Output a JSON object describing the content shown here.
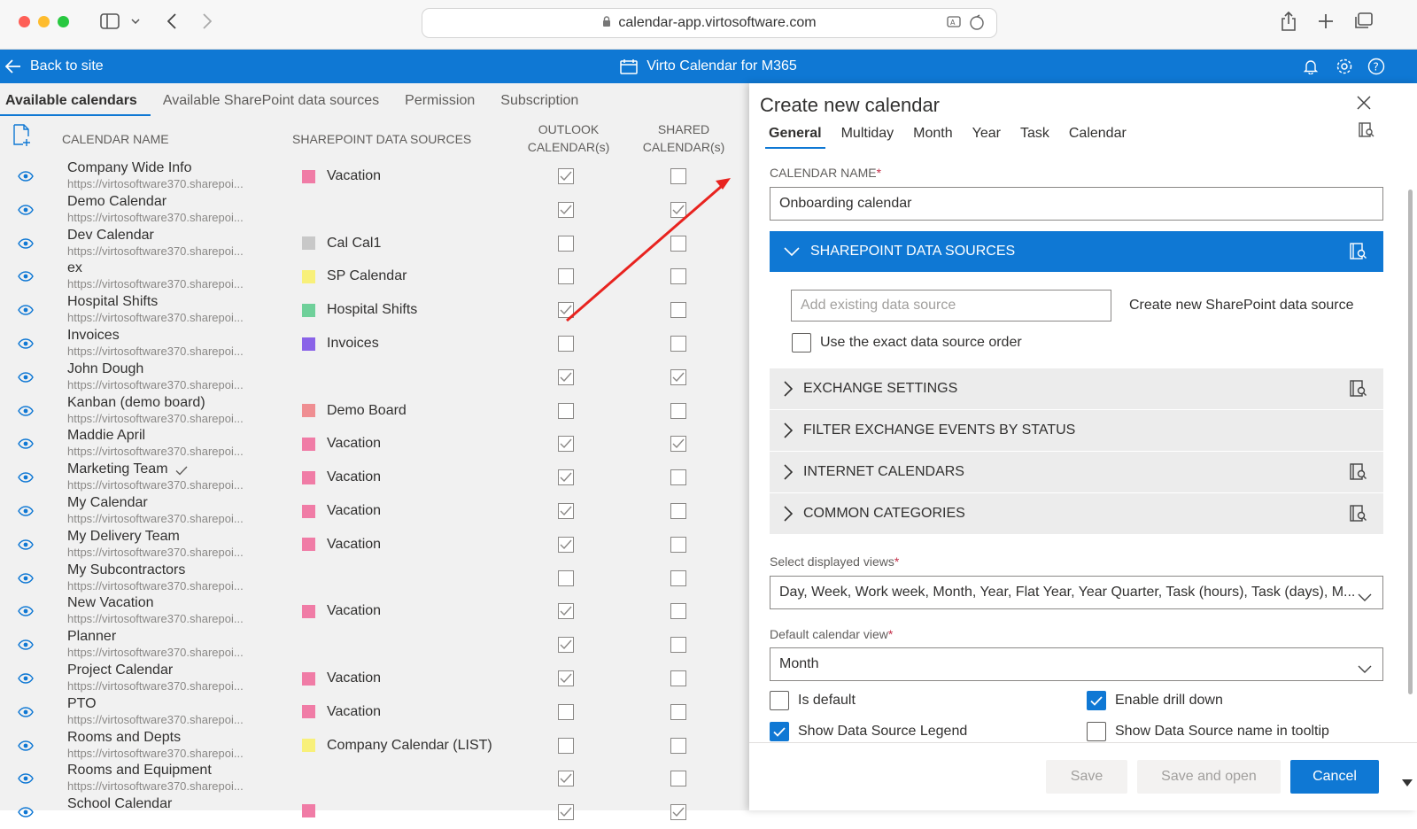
{
  "browser": {
    "url": "calendar-app.virtosoftware.com"
  },
  "appbar": {
    "back_label": "Back to site",
    "title": "Virto Calendar for M365"
  },
  "tabs": [
    "Available calendars",
    "Available SharePoint data sources",
    "Permission",
    "Subscription"
  ],
  "table": {
    "headers": {
      "name": "CALENDAR NAME",
      "sources": "SHAREPOINT DATA SOURCES",
      "outlook_1": "OUTLOOK",
      "outlook_2": "CALENDAR(s)",
      "shared_1": "SHARED",
      "shared_2": "CALENDAR(s)"
    },
    "rows": [
      {
        "name": "Company Wide Info",
        "url": "https://virtosoftware370.sharepoi...",
        "source": "Vacation",
        "color": "#f07ca6",
        "outlook": true,
        "shared": false
      },
      {
        "name": "Demo Calendar",
        "url": "https://virtosoftware370.sharepoi...",
        "source": "",
        "color": "",
        "outlook": true,
        "shared": true
      },
      {
        "name": "Dev Calendar",
        "url": "https://virtosoftware370.sharepoi...",
        "source": "Cal Cal1",
        "color": "#c8c8c8",
        "outlook": false,
        "shared": false
      },
      {
        "name": "ex",
        "url": "https://virtosoftware370.sharepoi...",
        "source": "SP Calendar",
        "color": "#f8f07a",
        "outlook": false,
        "shared": false
      },
      {
        "name": "Hospital Shifts",
        "url": "https://virtosoftware370.sharepoi...",
        "source": "Hospital Shifts",
        "color": "#6fd09a",
        "outlook": true,
        "shared": false
      },
      {
        "name": "Invoices",
        "url": "https://virtosoftware370.sharepoi...",
        "source": "Invoices",
        "color": "#8a63e8",
        "outlook": false,
        "shared": false
      },
      {
        "name": "John Dough",
        "url": "https://virtosoftware370.sharepoi...",
        "source": "",
        "color": "",
        "outlook": true,
        "shared": true
      },
      {
        "name": "Kanban (demo board)",
        "url": "https://virtosoftware370.sharepoi...",
        "source": "Demo Board",
        "color": "#ef8e92",
        "outlook": false,
        "shared": false
      },
      {
        "name": "Maddie April",
        "url": "https://virtosoftware370.sharepoi...",
        "source": "Vacation",
        "color": "#f07ca6",
        "outlook": true,
        "shared": true
      },
      {
        "name": "Marketing Team",
        "url": "https://virtosoftware370.sharepoi...",
        "source": "Vacation",
        "color": "#f07ca6",
        "outlook": true,
        "shared": false,
        "check": true
      },
      {
        "name": "My Calendar",
        "url": "https://virtosoftware370.sharepoi...",
        "source": "Vacation",
        "color": "#f07ca6",
        "outlook": true,
        "shared": false
      },
      {
        "name": "My Delivery Team",
        "url": "https://virtosoftware370.sharepoi...",
        "source": "Vacation",
        "color": "#f07ca6",
        "outlook": true,
        "shared": false
      },
      {
        "name": "My Subcontractors",
        "url": "https://virtosoftware370.sharepoi...",
        "source": "",
        "color": "",
        "outlook": false,
        "shared": false
      },
      {
        "name": "New Vacation",
        "url": "https://virtosoftware370.sharepoi...",
        "source": "Vacation",
        "color": "#f07ca6",
        "outlook": true,
        "shared": false
      },
      {
        "name": "Planner",
        "url": "https://virtosoftware370.sharepoi...",
        "source": "",
        "color": "",
        "outlook": true,
        "shared": false
      },
      {
        "name": "Project Calendar",
        "url": "https://virtosoftware370.sharepoi...",
        "source": "Vacation",
        "color": "#f07ca6",
        "outlook": true,
        "shared": false
      },
      {
        "name": "PTO",
        "url": "https://virtosoftware370.sharepoi...",
        "source": "Vacation",
        "color": "#f07ca6",
        "outlook": false,
        "shared": false
      },
      {
        "name": "Rooms and Depts",
        "url": "https://virtosoftware370.sharepoi...",
        "source": "Company Calendar (LIST)",
        "color": "#f8f07a",
        "outlook": false,
        "shared": false
      },
      {
        "name": "Rooms and Equipment",
        "url": "https://virtosoftware370.sharepoi...",
        "source": "",
        "color": "",
        "outlook": true,
        "shared": false
      },
      {
        "name": "School Calendar",
        "url": "",
        "source": "",
        "color": "#f07ca6",
        "outlook": true,
        "shared": true
      }
    ]
  },
  "panel": {
    "title": "Create new calendar",
    "tabs": [
      "General",
      "Multiday",
      "Month",
      "Year",
      "Task",
      "Calendar"
    ],
    "name_label": "CALENDAR NAME",
    "name_value": "Onboarding calendar",
    "sp_section": "SHAREPOINT DATA SOURCES",
    "add_source_placeholder": "Add existing data source",
    "create_source_link": "Create new SharePoint data source",
    "exact_order_label": "Use the exact data source order",
    "sections": [
      "EXCHANGE SETTINGS",
      "FILTER EXCHANGE EVENTS BY STATUS",
      "INTERNET CALENDARS",
      "COMMON CATEGORIES"
    ],
    "views_label": "Select displayed views",
    "views_value": "Day, Week, Work week, Month, Year, Flat Year, Year Quarter, Task (hours), Task (days), M...",
    "default_view_label": "Default calendar view",
    "default_view_value": "Month",
    "is_default": "Is default",
    "enable_drill": "Enable drill down",
    "show_legend": "Show Data Source Legend",
    "show_tooltip": "Show Data Source name in tooltip",
    "save": "Save",
    "save_open": "Save and open",
    "cancel": "Cancel"
  },
  "colors": {
    "accent": "#0f78d4",
    "arrow": "#e8231f"
  }
}
